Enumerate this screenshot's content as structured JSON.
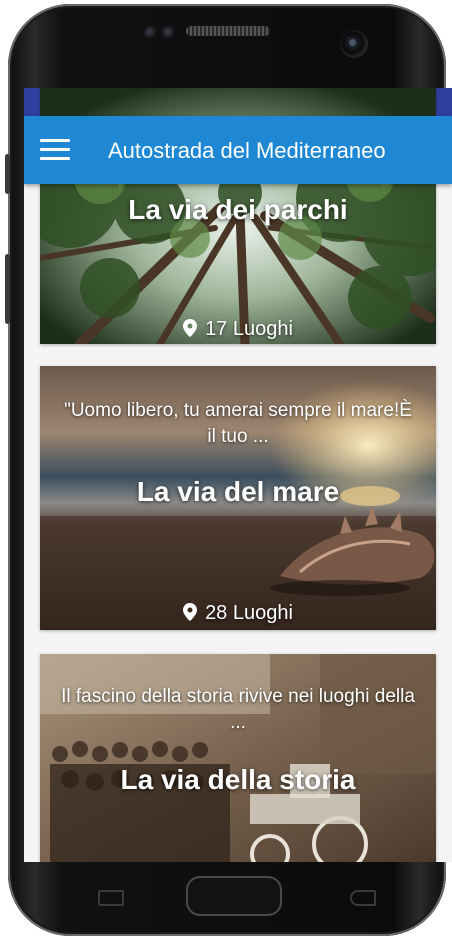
{
  "appbar": {
    "title": "Autostrada del Mediterraneo",
    "menu_icon": "hamburger-menu-icon"
  },
  "colors": {
    "status_bar": "#303f9f",
    "app_bar": "#1e88d4",
    "text_on_primary": "#ffffff"
  },
  "cards": [
    {
      "title": "La via dei parchi",
      "description": "",
      "places": "17 Luoghi",
      "places_icon": "map-pin-icon"
    },
    {
      "title": "La via del mare",
      "description": "\"Uomo libero, tu amerai sempre il mare!È il tuo ...",
      "places": "28 Luoghi",
      "places_icon": "map-pin-icon"
    },
    {
      "title": "La via della storia",
      "description": "Il fascino della storia rivive nei luoghi della ...",
      "places": "",
      "places_icon": "map-pin-icon"
    }
  ]
}
